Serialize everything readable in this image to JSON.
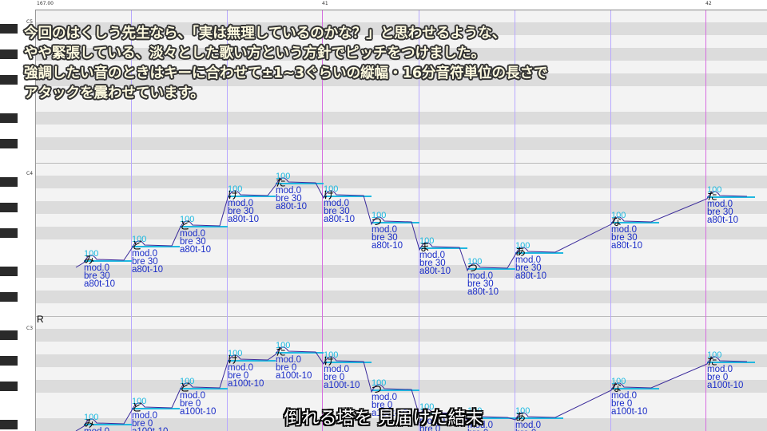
{
  "ruler": {
    "tempo": "167.00",
    "bar1": "41",
    "bar2": "42"
  },
  "piano": {
    "octaves": [
      "C5",
      "C4",
      "C3"
    ]
  },
  "caption": {
    "lines": [
      "今回のはくしう先生なら、「実は無理しているのかな？」と思わせるような、",
      "やや緊張している、淡々とした歌い方という方針でピッチをつけました。",
      "強調したい音のときはキーに合わせて±1~3ぐらいの縦幅・16分音符単位の長さで",
      "アタックを震わせています。"
    ]
  },
  "track_label": "R",
  "track1_notes": [
    {
      "vel": "100",
      "lyric": "み",
      "params": [
        "mod.0",
        "bre 30",
        "a80t-10"
      ]
    },
    {
      "vel": "100",
      "lyric": "ど",
      "params": [
        "mod.0",
        "bre 30",
        "a80t-10"
      ]
    },
    {
      "vel": "100",
      "lyric": "ど",
      "params": [
        "mod.0",
        "bre 30",
        "a80t-10"
      ]
    },
    {
      "vel": "100",
      "lyric": "け",
      "params": [
        "mod.0",
        "bre 30",
        "a80t-10"
      ]
    },
    {
      "vel": "100",
      "lyric": "た",
      "params": [
        "mod.0",
        "bre 30",
        "a80t-10"
      ]
    },
    {
      "vel": "100",
      "lyric": "け",
      "params": [
        "mod.0",
        "bre 30",
        "a80t-10"
      ]
    },
    {
      "vel": "100",
      "lyric": "つ",
      "params": [
        "mod.0",
        "bre 30",
        "a80t-10"
      ]
    },
    {
      "vel": "100",
      "lyric": "ま",
      "params": [
        "mod.0",
        "bre 30",
        "a80t-10"
      ]
    },
    {
      "vel": "100",
      "lyric": "つ",
      "params": [
        "mod.0",
        "bre 30",
        "a80t-10"
      ]
    },
    {
      "vel": "100",
      "lyric": "あ",
      "params": [
        "mod.0",
        "bre 30",
        "a80t-10"
      ]
    },
    {
      "vel": "100",
      "lyric": "な",
      "params": [
        "mod.0",
        "bre 30",
        "a80t-10"
      ]
    },
    {
      "vel": "100",
      "lyric": "た",
      "params": [
        "mod.0",
        "bre 30",
        "a80t-10"
      ]
    }
  ],
  "track2_notes": [
    {
      "vel": "100",
      "lyric": "み",
      "params": [
        "mod.0",
        "bre 0",
        "a100t-10"
      ]
    },
    {
      "vel": "100",
      "lyric": "ど",
      "params": [
        "mod.0",
        "bre 0",
        "a100t-10"
      ]
    },
    {
      "vel": "100",
      "lyric": "ど",
      "params": [
        "mod.0",
        "bre 0",
        "a100t-10"
      ]
    },
    {
      "vel": "100",
      "lyric": "け",
      "params": [
        "mod.0",
        "bre 0",
        "a100t-10"
      ]
    },
    {
      "vel": "100",
      "lyric": "た",
      "params": [
        "mod.0",
        "bre 0",
        "a100t-10"
      ]
    },
    {
      "vel": "100",
      "lyric": "け",
      "params": [
        "mod.0",
        "bre 0",
        "a100t-10"
      ]
    },
    {
      "vel": "100",
      "lyric": "つ",
      "params": [
        "mod.0",
        "bre 0",
        "a100t-10"
      ]
    },
    {
      "vel": "100",
      "lyric": "ま",
      "params": [
        "mod.0",
        "bre 0",
        "a100t-10"
      ]
    },
    {
      "vel": "100",
      "lyric": "つ",
      "params": [
        "mod.0",
        "bre 0",
        "a100t-10"
      ]
    },
    {
      "vel": "100",
      "lyric": "あ",
      "params": [
        "mod.0",
        "bre 0",
        "a100t-10"
      ]
    },
    {
      "vel": "100",
      "lyric": "な",
      "params": [
        "mod.0",
        "bre 0",
        "a100t-10"
      ]
    },
    {
      "vel": "100",
      "lyric": "た",
      "params": [
        "mod.0",
        "bre 0",
        "a100t-10"
      ]
    }
  ],
  "subtitle": "倒れる塔を 見届けた結末",
  "colors": {
    "note_bar": "#20b8e0",
    "pitch_curve": "#3a2a9a",
    "param_text": "#1a2cc8",
    "bar_line": "#d66ce0",
    "beat_line": "#b8a8ff"
  }
}
